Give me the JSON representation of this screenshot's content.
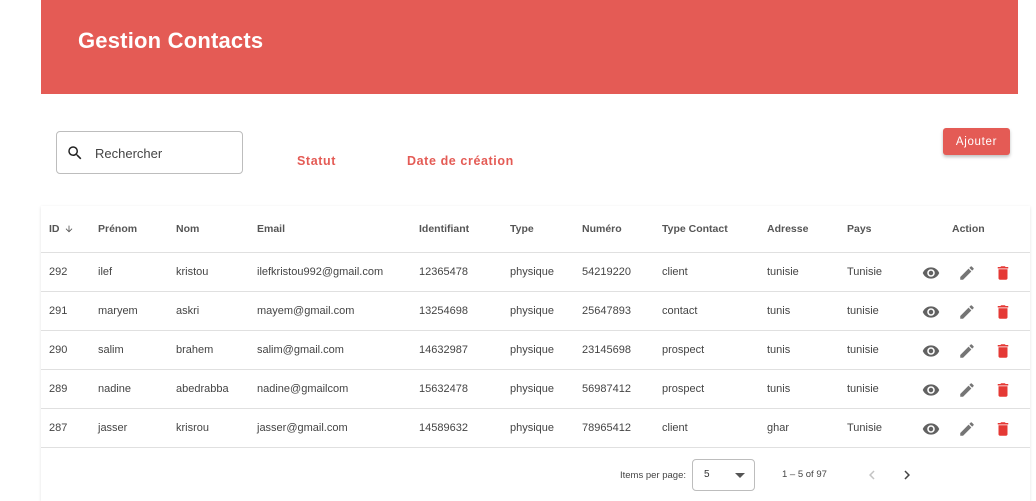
{
  "header": {
    "title": "Gestion Contacts"
  },
  "search": {
    "placeholder": "Rechercher",
    "icon": "search-icon"
  },
  "filters": {
    "statut": "Statut",
    "date": "Date de création"
  },
  "add_button": {
    "label": "Ajouter"
  },
  "colors": {
    "accent": "#e45b55",
    "view_icon": "#616161",
    "edit_icon": "#757575",
    "delete_icon": "#e53935"
  },
  "table": {
    "headers": [
      "ID",
      "Prénom",
      "Nom",
      "Email",
      "Identifiant",
      "Type",
      "Numéro",
      "Type Contact",
      "Adresse",
      "Pays",
      "Action"
    ],
    "sort_icon": "arrow-down-icon",
    "rows": [
      [
        "292",
        "ilef",
        "kristou",
        "ilefkristou992@gmail.com",
        "12365478",
        "physique",
        "54219220",
        "client",
        "tunisie",
        "Tunisie"
      ],
      [
        "291",
        "maryem",
        "askri",
        "mayem@gmail.com",
        "13254698",
        "physique",
        "25647893",
        "contact",
        "tunis",
        "tunisie"
      ],
      [
        "290",
        "salim",
        "brahem",
        "salim@gmail.com",
        "14632987",
        "physique",
        "23145698",
        "prospect",
        "tunis",
        "tunisie"
      ],
      [
        "289",
        "nadine",
        "abedrabba",
        "nadine@gmailcom",
        "15632478",
        "physique",
        "56987412",
        "prospect",
        "tunis",
        "tunisie"
      ],
      [
        "287",
        "jasser",
        "krisrou",
        "jasser@gmail.com",
        "14589632",
        "physique",
        "78965412",
        "client",
        "ghar",
        "Tunisie"
      ]
    ],
    "row_actions": [
      "eye-icon",
      "pencil-icon",
      "trash-icon"
    ]
  },
  "paginator": {
    "items_per_page_label": "Items per page:",
    "page_size": "5",
    "range_label": "1 – 5 of 97"
  }
}
